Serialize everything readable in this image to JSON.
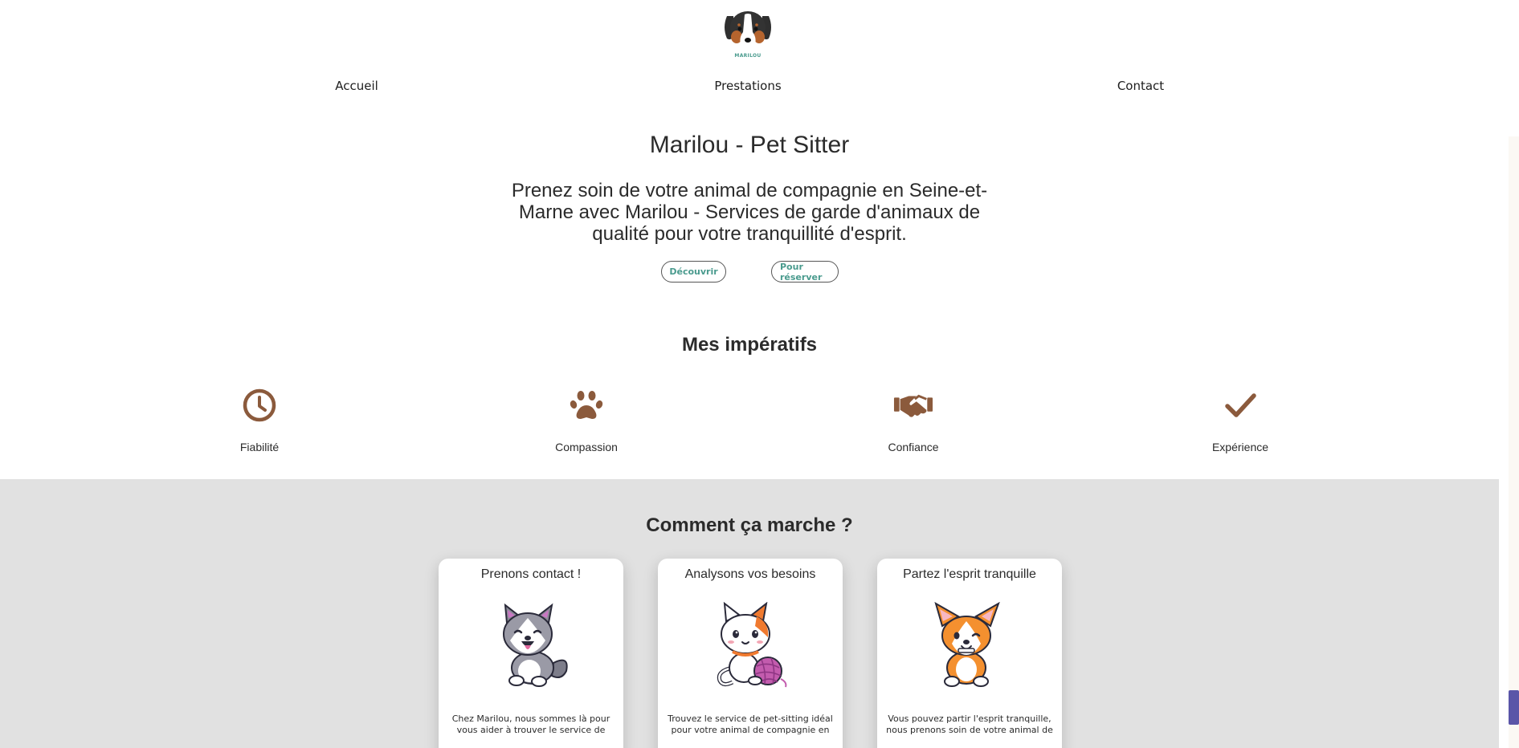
{
  "header": {
    "logo_text": "MARILOU",
    "nav": [
      {
        "label": "Accueil"
      },
      {
        "label": "Prestations"
      },
      {
        "label": "Contact"
      }
    ]
  },
  "hero": {
    "title": "Marilou - Pet Sitter",
    "subtitle": "Prenez soin de votre animal de compagnie en Seine-et-Marne avec Marilou - Services de garde d'animaux de qualité pour votre tranquillité d'esprit.",
    "buttons": [
      {
        "label": "Découvrir"
      },
      {
        "label": "Pour réserver"
      }
    ]
  },
  "imperatifs": {
    "title": "Mes impératifs",
    "items": [
      {
        "label": "Fiabilité",
        "icon": "clock-icon"
      },
      {
        "label": "Compassion",
        "icon": "paw-icon"
      },
      {
        "label": "Confiance",
        "icon": "handshake-icon"
      },
      {
        "label": "Expérience",
        "icon": "check-icon"
      }
    ]
  },
  "how": {
    "title": "Comment ça marche ?",
    "cards": [
      {
        "title": "Prenons contact !",
        "image": "husky-illustration",
        "text": "Chez Marilou, nous sommes là pour vous aider à trouver le service de"
      },
      {
        "title": "Analysons vos besoins",
        "image": "cat-illustration",
        "text": "Trouvez le service de pet-sitting idéal pour votre animal de compagnie en"
      },
      {
        "title": "Partez l'esprit tranquille",
        "image": "corgi-illustration",
        "text": "Vous pouvez partir l'esprit tranquille, nous prenons soin de votre animal de"
      }
    ]
  },
  "colors": {
    "accent_brown": "#8b5a3c",
    "accent_teal": "#4a9b8e",
    "section_gray": "#e1e1e1",
    "scroll_thumb": "#5a55a8"
  }
}
